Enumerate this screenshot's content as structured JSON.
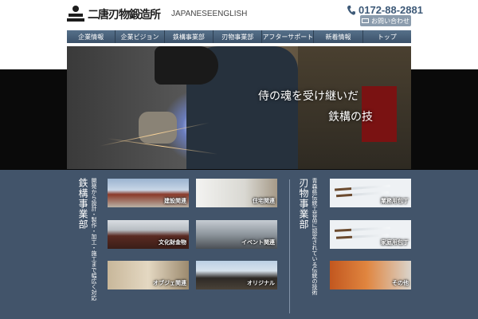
{
  "header": {
    "logo_text": "二唐刃物鍛造所",
    "lang_japanese": "JAPANESE",
    "lang_english": "ENGLISH",
    "phone": "0172-88-2881",
    "contact_label": "お問い合わせ"
  },
  "nav": {
    "items": [
      {
        "label": "企業情報"
      },
      {
        "label": "企業ビジョン"
      },
      {
        "label": "鉄構事業部"
      },
      {
        "label": "刃物事業部"
      },
      {
        "label": "アフターサポート"
      },
      {
        "label": "新着情報"
      },
      {
        "label": "トップ"
      }
    ]
  },
  "hero": {
    "line1": "侍の魂を受け継いだ",
    "line2": "鉄構の技"
  },
  "ironworks": {
    "title": "鉄構事業部",
    "description": "開発から設計・製作・加工・施工まで幅広く対応",
    "tiles": [
      {
        "label": "建設関連"
      },
      {
        "label": "住宅関連"
      },
      {
        "label": "文化財金物"
      },
      {
        "label": "イベント関連"
      },
      {
        "label": "オブジェ関連"
      },
      {
        "label": "オリジナル"
      }
    ]
  },
  "cutlery": {
    "title": "刃物事業部",
    "description": "青森県伝統工芸品に認定されている伝統の技術",
    "tiles": [
      {
        "label": "業務用包丁"
      },
      {
        "label": "家庭用包丁"
      },
      {
        "label": "その他"
      }
    ]
  },
  "colors": {
    "nav": "#4a6078",
    "lower_bg": "#42546a",
    "accent": "#3e5a78"
  }
}
